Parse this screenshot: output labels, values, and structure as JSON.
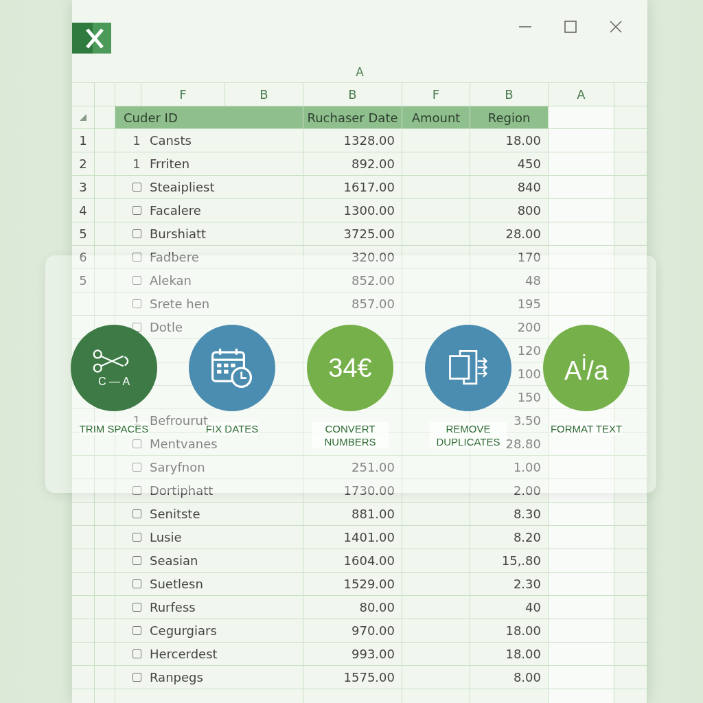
{
  "sheet_title": "A",
  "column_letters": [
    "F",
    "B",
    "B",
    "F",
    "B",
    "A"
  ],
  "header": {
    "name": "Cuder ID",
    "date": "Ruchaser Date",
    "amount": "Amount",
    "region": "Region"
  },
  "rows": [
    {
      "num": "1",
      "marker": "1",
      "name": "Cansts",
      "date": "1328.00",
      "region": "18.00"
    },
    {
      "num": "2",
      "marker": "1",
      "name": "Frriten",
      "date": "892.00",
      "region": "450"
    },
    {
      "num": "3",
      "checked": false,
      "name": "Steaipliest",
      "date": "1617.00",
      "region": "840"
    },
    {
      "num": "4",
      "checked": false,
      "name": "Facalere",
      "date": "1300.00",
      "region": "800"
    },
    {
      "num": "5",
      "checked": false,
      "name": "Burshiatt",
      "date": "3725.00",
      "region": "28.00"
    },
    {
      "num": "6",
      "checked": false,
      "name": "Fadbere",
      "date": "320.00",
      "region": "170"
    },
    {
      "num": "5",
      "checked": false,
      "name": "Alekan",
      "date": "852.00",
      "region": "48"
    },
    {
      "checked": false,
      "name": "Srete hen",
      "date": "857.00",
      "region": "195"
    },
    {
      "checked": false,
      "name": "Dotle",
      "region": "200"
    },
    {
      "region": "120"
    },
    {
      "region": "100"
    },
    {
      "region": "150"
    },
    {
      "marker": "1",
      "name": "Befrourut",
      "region": "3.50"
    },
    {
      "checked": false,
      "name": "Mentvanes",
      "region": "28.80"
    },
    {
      "checked": false,
      "name": "Saryfnon",
      "date": "251.00",
      "region": "1.00"
    },
    {
      "checked": false,
      "name": "Dortiphatt",
      "date": "1730.00",
      "region": "2.00"
    },
    {
      "checked": false,
      "name": "Senitste",
      "date": "881.00",
      "region": "8.30"
    },
    {
      "checked": false,
      "name": "Lusie",
      "date": "1401.00",
      "region": "8.20"
    },
    {
      "checked": false,
      "name": "Seasian",
      "date": "1604.00",
      "region": "15,.80"
    },
    {
      "checked": false,
      "name": "Suetlesn",
      "date": "1529.00",
      "region": "2.30"
    },
    {
      "checked": false,
      "name": "Rurfess",
      "date": "80.00",
      "region": "40"
    },
    {
      "checked": false,
      "name": "Cegurgiars",
      "date": "970.00",
      "region": "18.00"
    },
    {
      "checked": false,
      "name": "Hercerdest",
      "date": "993.00",
      "region": "18.00"
    },
    {
      "checked": false,
      "name": "Ranpegs",
      "date": "1575.00",
      "region": "8.00"
    }
  ],
  "tools": [
    {
      "kind": "trim",
      "label": "TRIM SPACES",
      "icon_text": "C — A",
      "color": "#3d7a45"
    },
    {
      "kind": "dates",
      "label": "FIX DATES",
      "color": "#4a8db0"
    },
    {
      "kind": "convert",
      "label": "CONVERT NUMBERS",
      "icon_text": "34€",
      "color": "#76b04a"
    },
    {
      "kind": "duplicates",
      "label": "REMOVE DUPLICATES",
      "color": "#4a8db0"
    },
    {
      "kind": "format",
      "label": "FORMAT TEXT",
      "icon_text": "A$^{i}$/a",
      "color": "#76b04a"
    }
  ]
}
